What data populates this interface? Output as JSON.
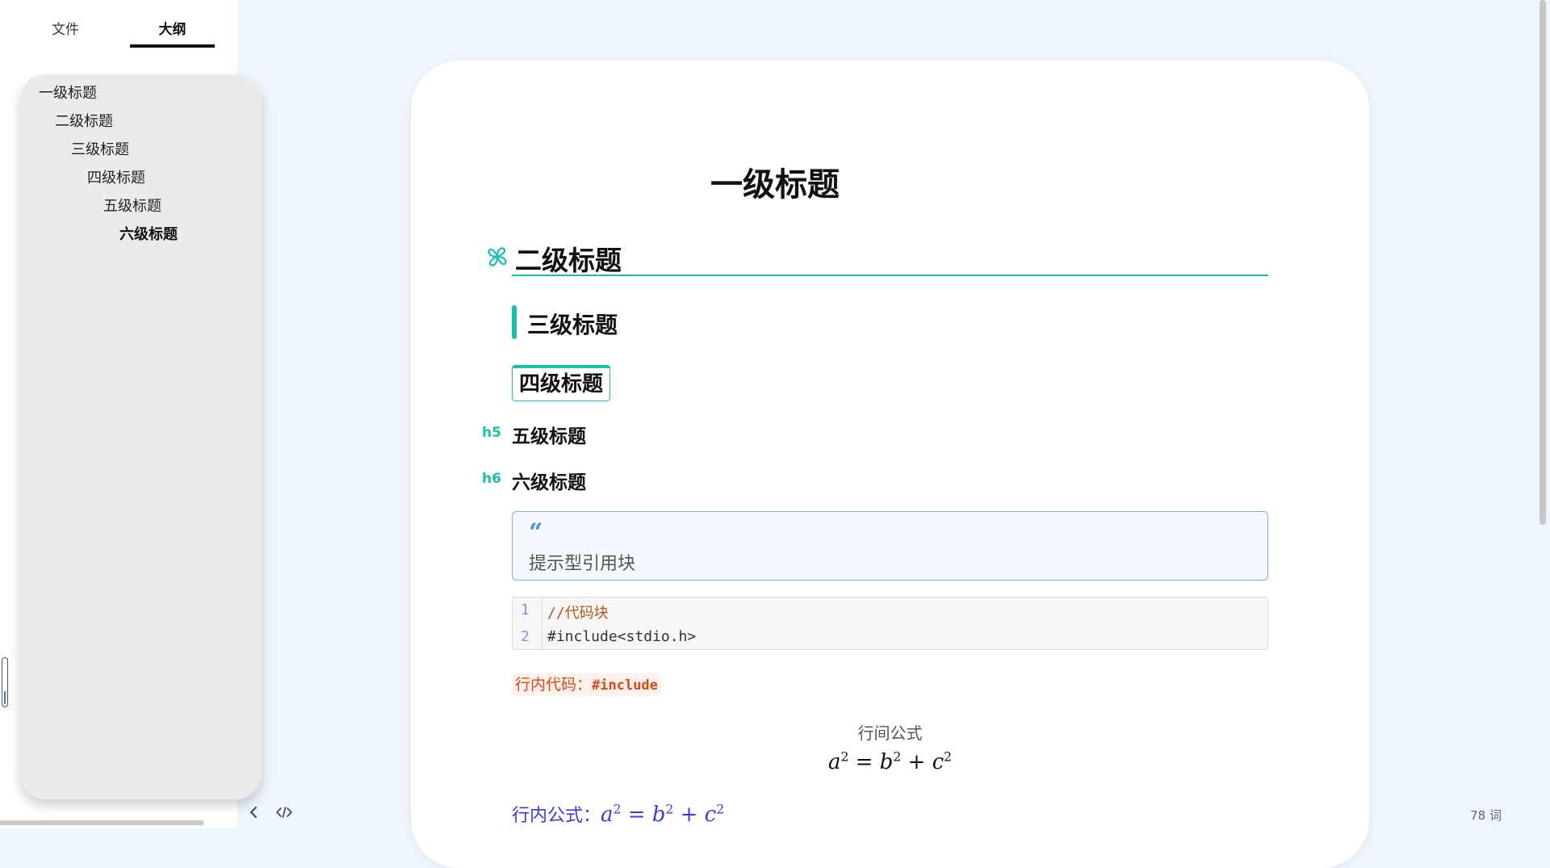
{
  "sidebar": {
    "tabs": [
      {
        "label": "文件"
      },
      {
        "label": "大纲"
      }
    ],
    "outline_items": [
      {
        "label": "一级标题"
      },
      {
        "label": "二级标题"
      },
      {
        "label": "三级标题"
      },
      {
        "label": "四级标题"
      },
      {
        "label": "五级标题"
      },
      {
        "label": "六级标题"
      }
    ]
  },
  "document": {
    "h1": "一级标题",
    "h2": "二级标题",
    "h3": "三级标题",
    "h4": "四级标题",
    "h5_tag": "h5",
    "h5": "五级标题",
    "h6_tag": "h6",
    "h6": "六级标题",
    "callout": {
      "quote_mark": "“",
      "text": "提示型引用块"
    },
    "code_block": {
      "lines": [
        {
          "num": "1",
          "text": "//代码块"
        },
        {
          "num": "2",
          "text": "#include<stdio.h>"
        }
      ]
    },
    "inline_code": {
      "label": "行内代码：",
      "code": "#include"
    },
    "math_block": {
      "label": "行间公式"
    },
    "inline_math": {
      "label": "行内公式："
    }
  },
  "status": {
    "word_count": "78 词"
  },
  "icons": {
    "h2_icon": "pinwheel-icon",
    "back": "chevron-left-icon",
    "source": "code-view-icon"
  },
  "colors": {
    "accent": "#1bbfb0",
    "callout_border": "#7fb1e6",
    "inline_code": "#d9481c",
    "inline_math": "#3a3ae0"
  }
}
